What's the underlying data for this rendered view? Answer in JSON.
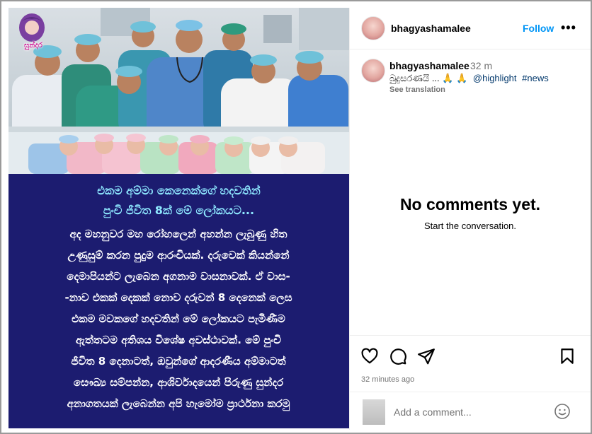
{
  "post": {
    "caption_title_lines": [
      "එකම අම්මා කෙනෙක්ගේ හදවතින්",
      "පුංචි ජීවිත 8ක් මේ ලෝකයට..."
    ],
    "caption_body_lines": [
      "අද මහනුවර මහ රෝහලෙන් අහන්න ලැබුණු හිත",
      "උණුසුම් කරන පුදුම ආරංචියක්. දරුවෙක් කියන්නේ",
      "දෙමාපියන්ට ලැබෙන අගනාම වාසනාවක්. ඒ වාස-",
      "-නාව එකක් දෙකක් නොව දරුවන් 8 දෙනෙක් ලෙස",
      "එකම මවකගේ හදවතින් මේ ලෝකයට පැමිණීම",
      "ඇත්තටම අතිශය විශේෂ අවස්ථාවක්. මේ පුංචි",
      "ජීවිත 8 දෙනාටත්, ඔවුන්ගේ ආදරණීය අම්මාටත්",
      "සෞඛ්‍ය සම්පන්න, ආශිර්වාදයෙන් පිරුණු සුන්දර",
      "අනාගතයක් ලැබෙන්න අපි හැමෝම ප්‍රාර්ථනා කරමු"
    ],
    "logo_text": "සුන්දර"
  },
  "header": {
    "username": "bhagyashamalee",
    "follow_label": "Follow",
    "more_label": "•••"
  },
  "comment": {
    "username": "bhagyashamalee",
    "time": "32 m",
    "text": "බුදුසරණයි ... 🙏 🙏",
    "hashtags": [
      "@highlight",
      "#news"
    ],
    "see_translation": "See translation"
  },
  "empty": {
    "title": "No comments yet.",
    "subtitle": "Start the conversation."
  },
  "actions": {
    "timestamp": "32 minutes ago"
  },
  "add_comment": {
    "placeholder": "Add a comment..."
  },
  "colors": {
    "link_blue": "#0095f6",
    "caption_panel": "#1c1c70",
    "caption_title": "#8ee8ff"
  }
}
